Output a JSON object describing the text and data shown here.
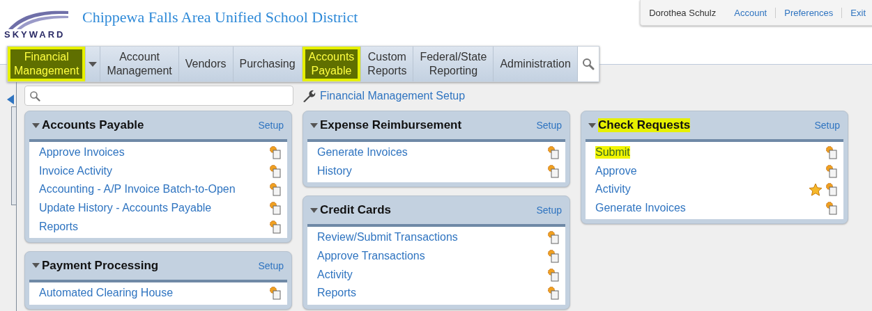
{
  "header": {
    "logo": "SKYWARD",
    "title": "Chippewa Falls Area Unified School District"
  },
  "user_bar": {
    "user": "Dorothea Schulz",
    "links": [
      "Account",
      "Preferences",
      "Exit"
    ]
  },
  "tabs": [
    {
      "label": "Financial Management",
      "highlighted": true,
      "dropdown": true
    },
    {
      "label": "Account Management",
      "highlighted": false,
      "dropdown": false
    },
    {
      "label": "Vendors",
      "highlighted": false,
      "dropdown": false
    },
    {
      "label": "Purchasing",
      "highlighted": false,
      "dropdown": false
    },
    {
      "label": "Accounts Payable",
      "highlighted": true,
      "dropdown": false
    },
    {
      "label": "Custom Reports",
      "highlighted": false,
      "dropdown": false
    },
    {
      "label": "Federal/State Reporting",
      "highlighted": false,
      "dropdown": false
    },
    {
      "label": "Administration",
      "highlighted": false,
      "dropdown": false
    }
  ],
  "setup_link": "Financial Management Setup",
  "columns": [
    [
      {
        "title": "Accounts Payable",
        "highlighted": false,
        "setup": "Setup",
        "items": [
          {
            "label": "Approve Invoices",
            "highlighted": false,
            "favorite": false
          },
          {
            "label": "Invoice Activity",
            "highlighted": false,
            "favorite": false
          },
          {
            "label": "Accounting - A/P Invoice Batch-to-Open",
            "highlighted": false,
            "favorite": false
          },
          {
            "label": "Update History - Accounts Payable",
            "highlighted": false,
            "favorite": false
          },
          {
            "label": "Reports",
            "highlighted": false,
            "favorite": false
          }
        ]
      },
      {
        "title": "Payment Processing",
        "highlighted": false,
        "setup": "Setup",
        "items": [
          {
            "label": "Automated Clearing House",
            "highlighted": false,
            "favorite": false
          }
        ]
      }
    ],
    [
      {
        "title": "Expense Reimbursement",
        "highlighted": false,
        "setup": "Setup",
        "items": [
          {
            "label": "Generate Invoices",
            "highlighted": false,
            "favorite": false
          },
          {
            "label": "History",
            "highlighted": false,
            "favorite": false
          }
        ]
      },
      {
        "title": "Credit Cards",
        "highlighted": false,
        "setup": "Setup",
        "items": [
          {
            "label": "Review/Submit Transactions",
            "highlighted": false,
            "favorite": false
          },
          {
            "label": "Approve Transactions",
            "highlighted": false,
            "favorite": false
          },
          {
            "label": "Activity",
            "highlighted": false,
            "favorite": false
          },
          {
            "label": "Reports",
            "highlighted": false,
            "favorite": false
          }
        ]
      }
    ],
    [
      {
        "title": "Check Requests",
        "highlighted": true,
        "setup": "Setup",
        "items": [
          {
            "label": "Submit",
            "highlighted": true,
            "favorite": false
          },
          {
            "label": "Approve",
            "highlighted": false,
            "favorite": false
          },
          {
            "label": "Activity",
            "highlighted": false,
            "favorite": true
          },
          {
            "label": "Generate Invoices",
            "highlighted": false,
            "favorite": false
          }
        ]
      }
    ]
  ]
}
